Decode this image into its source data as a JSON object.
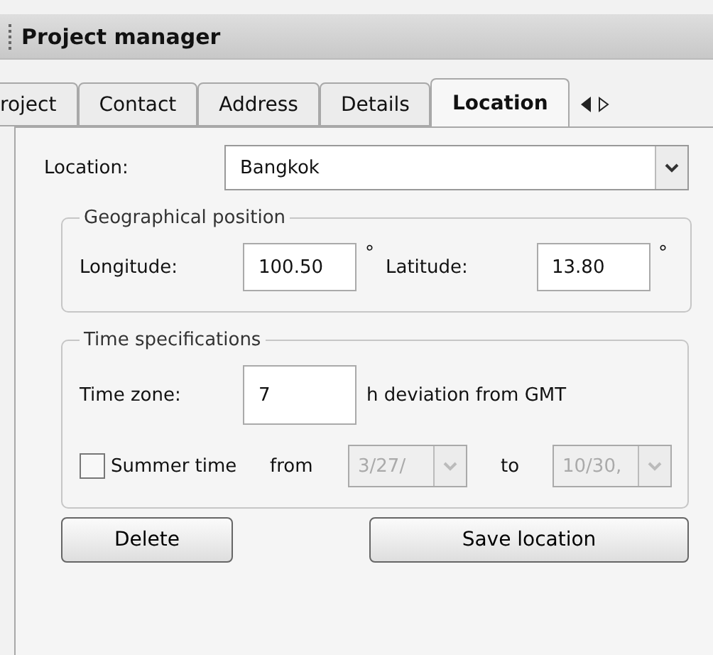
{
  "window": {
    "title": "Project manager"
  },
  "tabs": [
    {
      "label": "roject",
      "selected": false
    },
    {
      "label": "Contact",
      "selected": false
    },
    {
      "label": "Address",
      "selected": false
    },
    {
      "label": "Details",
      "selected": false
    },
    {
      "label": "Location",
      "selected": true
    }
  ],
  "location": {
    "label": "Location:",
    "value": "Bangkok"
  },
  "geographical_position": {
    "legend": "Geographical position",
    "longitude": {
      "label": "Longitude:",
      "value": "100.50",
      "unit": "°"
    },
    "latitude": {
      "label": "Latitude:",
      "value": "13.80",
      "unit": "°"
    }
  },
  "time_specifications": {
    "legend": "Time specifications",
    "time_zone": {
      "label": "Time zone:",
      "value": "7",
      "note": "h deviation from GMT"
    },
    "summer_time": {
      "label": "Summer time",
      "checked": false,
      "from_label": "from",
      "from_value": "3/27/",
      "to_label": "to",
      "to_value": "10/30,",
      "disabled": true
    }
  },
  "buttons": [
    "Delete",
    "Save location"
  ]
}
